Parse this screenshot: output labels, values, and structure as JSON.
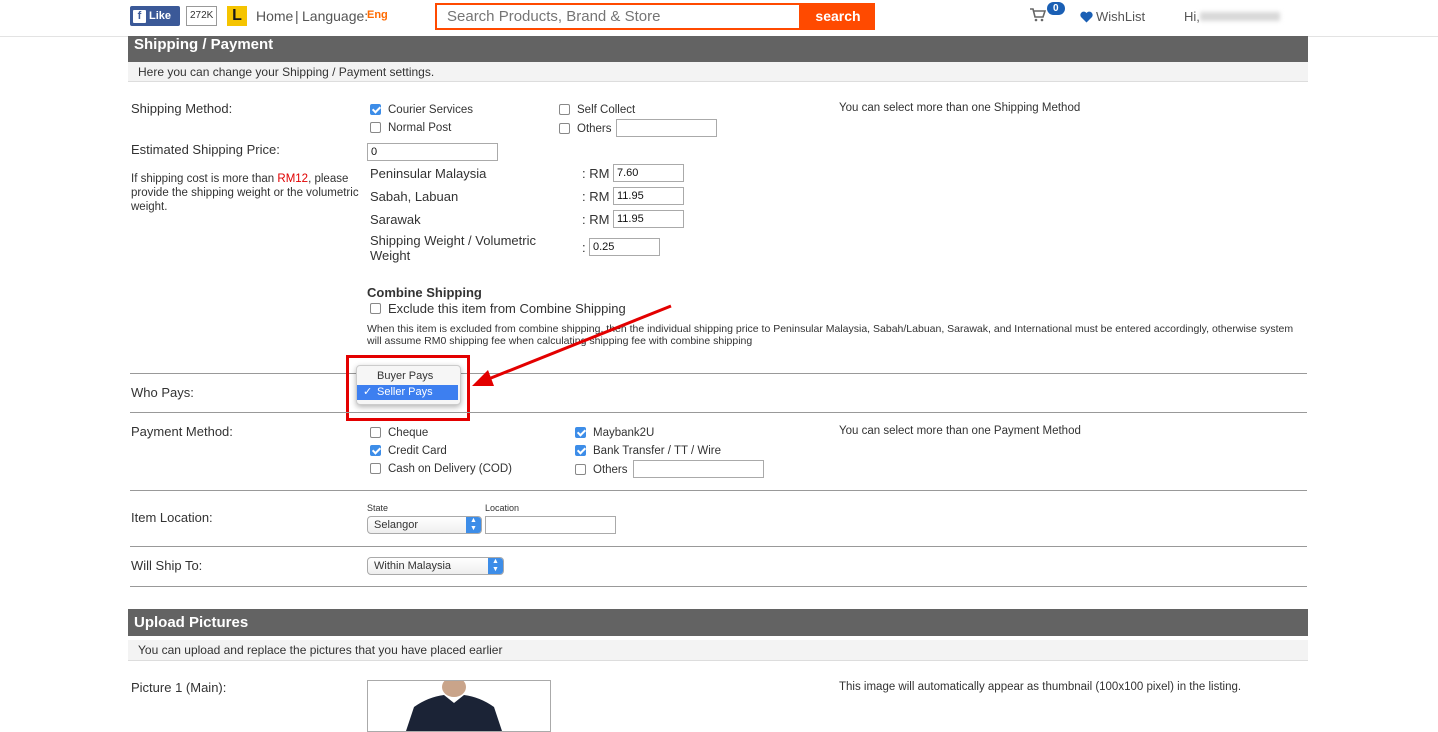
{
  "header": {
    "fb_like": "Like",
    "fb_count": "272K",
    "logo_letter": "L",
    "home": "Home",
    "sep": "|",
    "language_label": "Language:",
    "language_value": "Eng",
    "search_placeholder": "Search Products, Brand & Store",
    "search_button": "search",
    "cart_count": "0",
    "wishlist": "WishList",
    "greeting": "Hi,"
  },
  "shipping": {
    "section_title": "Shipping / Payment",
    "section_desc": "Here you can change your Shipping / Payment settings.",
    "method_label": "Shipping Method:",
    "methods": {
      "courier": "Courier Services",
      "normal": "Normal Post",
      "self_collect": "Self Collect",
      "others": "Others"
    },
    "method_hint": "You can select more than one Shipping Method",
    "est_label": "Estimated Shipping Price:",
    "est_value": "0",
    "note_pre": "If shipping cost is more than ",
    "note_rm": "RM12",
    "note_post": ", please provide the shipping weight or the volumetric weight.",
    "rates": [
      {
        "region": "Peninsular Malaysia",
        "prefix": ": RM",
        "value": "7.60"
      },
      {
        "region": "Sabah, Labuan",
        "prefix": ": RM",
        "value": "11.95"
      },
      {
        "region": "Sarawak",
        "prefix": ": RM",
        "value": "11.95"
      }
    ],
    "weight_label": "Shipping Weight / Volumetric Weight",
    "weight_prefix": ":",
    "weight_value": "0.25",
    "combine_title": "Combine Shipping",
    "combine_exclude": "Exclude this item from Combine Shipping",
    "combine_note": "When this item is excluded from combine shipping, then the individual shipping price to Peninsular Malaysia, Sabah/Labuan, Sarawak, and International must be entered accordingly, otherwise system will assume RM0 shipping fee when calculating shipping fee with combine shipping",
    "who_pays_label": "Who Pays:",
    "who_pays_options": [
      "Buyer Pays",
      "Seller Pays"
    ],
    "who_pays_selected": "Seller Pays"
  },
  "payment": {
    "label": "Payment Method:",
    "methods": {
      "cheque": "Cheque",
      "credit": "Credit Card",
      "cod": "Cash on Delivery (COD)",
      "maybank": "Maybank2U",
      "bank": "Bank Transfer / TT / Wire",
      "others": "Others"
    },
    "hint": "You can select more than one Payment Method"
  },
  "location": {
    "label": "Item Location:",
    "state_label": "State",
    "state_value": "Selangor",
    "location_label": "Location"
  },
  "ship_to": {
    "label": "Will Ship To:",
    "value": "Within Malaysia"
  },
  "pictures": {
    "section_title": "Upload Pictures",
    "section_desc": "You can upload and replace the pictures that you have placed earlier",
    "picture1_label": "Picture 1 (Main):",
    "picture_hint": "This image will automatically appear as thumbnail (100x100 pixel) in the listing."
  },
  "colors": {
    "accent": "#ff4a00",
    "section_bar": "#636363",
    "checkbox_on": "#3d8de8",
    "annotation": "#e30000"
  }
}
